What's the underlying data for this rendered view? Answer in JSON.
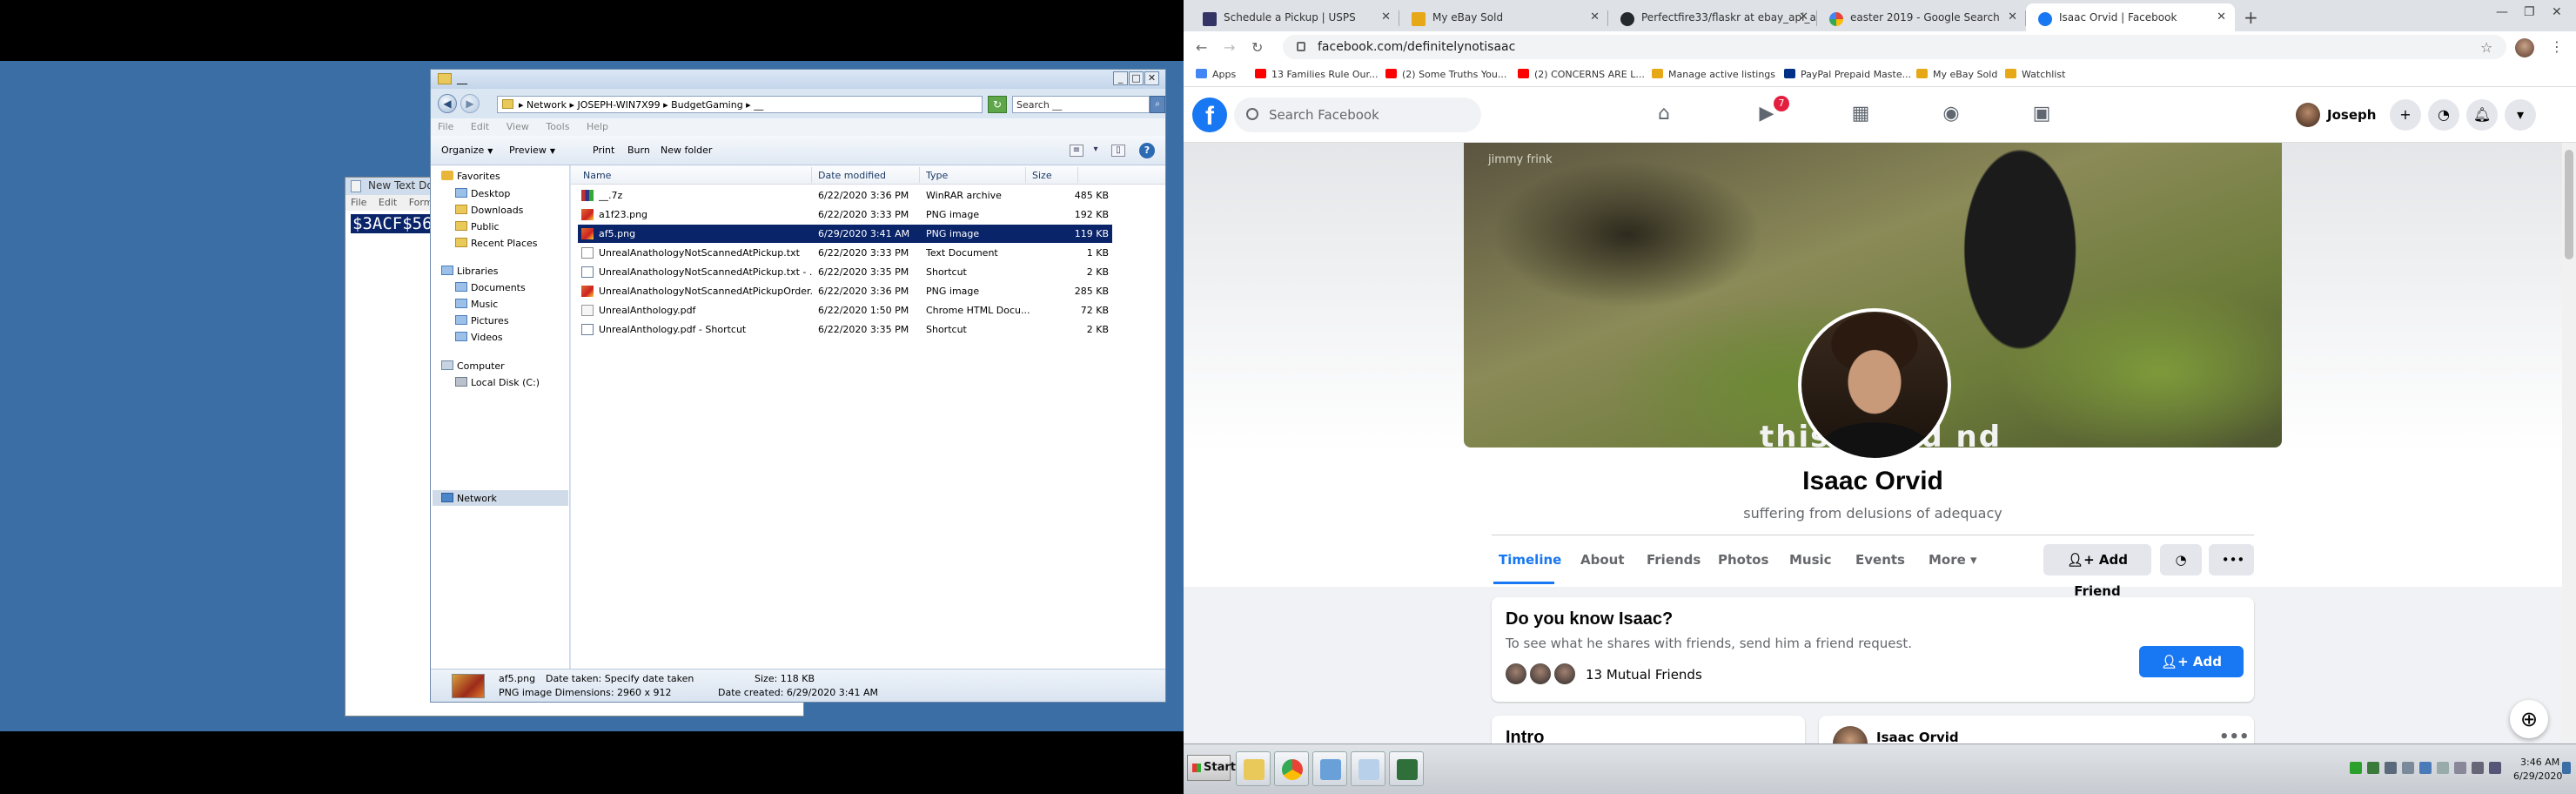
{
  "notepad": {
    "title": "New Text Doc",
    "menu": [
      "File",
      "Edit",
      "Forma"
    ],
    "selected_text": "$3ACF$56"
  },
  "explorer": {
    "title": "__",
    "breadcrumb": "▸ Network ▸ JOSEPH-WIN7X99 ▸ BudgetGaming ▸ __",
    "search_placeholder": "Search __",
    "menu": [
      "File",
      "Edit",
      "View",
      "Tools",
      "Help"
    ],
    "toolbar": {
      "organize": "Organize",
      "preview": "Preview",
      "print": "Print",
      "burn": "Burn",
      "new_folder": "New folder"
    },
    "nav": {
      "favorites": "Favorites",
      "desktop": "Desktop",
      "downloads": "Downloads",
      "public": "Public",
      "recent": "Recent Places",
      "libraries": "Libraries",
      "documents": "Documents",
      "music": "Music",
      "pictures": "Pictures",
      "videos": "Videos",
      "computer": "Computer",
      "local_disk": "Local Disk (C:)",
      "network": "Network"
    },
    "columns": {
      "name": "Name",
      "date": "Date modified",
      "type": "Type",
      "size": "Size"
    },
    "files": [
      {
        "name": "__.7z",
        "date": "6/22/2020 3:36 PM",
        "type": "WinRAR archive",
        "size": "485 KB"
      },
      {
        "name": "a1f23.png",
        "date": "6/22/2020 3:33 PM",
        "type": "PNG image",
        "size": "192 KB"
      },
      {
        "name": "af5.png",
        "date": "6/29/2020 3:41 AM",
        "type": "PNG image",
        "size": "119 KB"
      },
      {
        "name": "UnrealAnathologyNotScannedAtPickup.txt",
        "date": "6/22/2020 3:33 PM",
        "type": "Text Document",
        "size": "1 KB"
      },
      {
        "name": "UnrealAnathologyNotScannedAtPickup.txt - ...",
        "date": "6/22/2020 3:35 PM",
        "type": "Shortcut",
        "size": "2 KB"
      },
      {
        "name": "UnrealAnathologyNotScannedAtPickupOrder...",
        "date": "6/22/2020 3:36 PM",
        "type": "PNG image",
        "size": "285 KB"
      },
      {
        "name": "UnrealAnthology.pdf",
        "date": "6/22/2020 1:50 PM",
        "type": "Chrome HTML Docu...",
        "size": "72 KB"
      },
      {
        "name": "UnrealAnthology.pdf - Shortcut",
        "date": "6/22/2020 3:35 PM",
        "type": "Shortcut",
        "size": "2 KB"
      }
    ],
    "details": {
      "filename": "af5.png",
      "date_taken": "Date taken: Specify date taken",
      "size": "Size: 118 KB",
      "type_dims": "PNG image Dimensions: 2960 x 912",
      "date_created": "Date created: 6/29/2020 3:41 AM"
    }
  },
  "chrome": {
    "tabs": [
      {
        "title": "Schedule a Pickup | USPS",
        "favicon_color": "#333366"
      },
      {
        "title": "My eBay Sold",
        "favicon_color": "#e6a817"
      },
      {
        "title": "Perfectfire33/flaskr at ebay_api_ad...",
        "favicon_color": "#24292e"
      },
      {
        "title": "easter 2019 - Google Search",
        "favicon_color": "#4285f4"
      },
      {
        "title": "Isaac Orvid | Facebook",
        "favicon_color": "#1877f2"
      }
    ],
    "url": "facebook.com/definitelynotisaac",
    "bookmarks": [
      {
        "label": "Apps",
        "color": "#4285f4"
      },
      {
        "label": "13 Families Rule Our...",
        "color": "#ff0000"
      },
      {
        "label": "(2) Some Truths You...",
        "color": "#ff0000"
      },
      {
        "label": "(2) CONCERNS ARE L...",
        "color": "#ff0000"
      },
      {
        "label": "Manage active listings",
        "color": "#e6a817"
      },
      {
        "label": "PayPal Prepaid Maste...",
        "color": "#003087"
      },
      {
        "label": "My eBay Sold",
        "color": "#e6a817"
      },
      {
        "label": "Watchlist",
        "color": "#e6a817"
      }
    ]
  },
  "facebook": {
    "search_placeholder": "Search Facebook",
    "video_badge": "7",
    "user_name": "Joseph",
    "cover_credit": "jimmy frink",
    "cover_caption": "this         u    had    nd",
    "profile_name": "Isaac Orvid",
    "bio": "suffering from delusions of adequacy",
    "tabs": [
      "Timeline",
      "About",
      "Friends",
      "Photos",
      "Music",
      "Events",
      "More ▾"
    ],
    "add_friend": "Add Friend",
    "know_title": "Do you know Isaac?",
    "know_sub": "To see what he shares with friends, send him a friend request.",
    "mutual_friends": "13 Mutual Friends",
    "intro_title": "Intro",
    "post_author": "Isaac Orvid",
    "post_more": "•••"
  },
  "taskbar": {
    "start": "Start",
    "time": "3:46 AM",
    "date": "6/29/2020"
  }
}
